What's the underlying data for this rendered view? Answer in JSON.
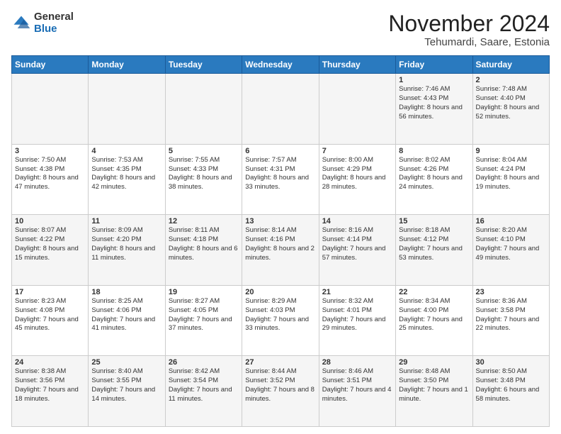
{
  "logo": {
    "general": "General",
    "blue": "Blue"
  },
  "title": {
    "month_year": "November 2024",
    "location": "Tehumardi, Saare, Estonia"
  },
  "weekdays": [
    "Sunday",
    "Monday",
    "Tuesday",
    "Wednesday",
    "Thursday",
    "Friday",
    "Saturday"
  ],
  "weeks": [
    [
      {
        "day": "",
        "sunrise": "",
        "sunset": "",
        "daylight": ""
      },
      {
        "day": "",
        "sunrise": "",
        "sunset": "",
        "daylight": ""
      },
      {
        "day": "",
        "sunrise": "",
        "sunset": "",
        "daylight": ""
      },
      {
        "day": "",
        "sunrise": "",
        "sunset": "",
        "daylight": ""
      },
      {
        "day": "",
        "sunrise": "",
        "sunset": "",
        "daylight": ""
      },
      {
        "day": "1",
        "sunrise": "Sunrise: 7:46 AM",
        "sunset": "Sunset: 4:43 PM",
        "daylight": "Daylight: 8 hours and 56 minutes."
      },
      {
        "day": "2",
        "sunrise": "Sunrise: 7:48 AM",
        "sunset": "Sunset: 4:40 PM",
        "daylight": "Daylight: 8 hours and 52 minutes."
      }
    ],
    [
      {
        "day": "3",
        "sunrise": "Sunrise: 7:50 AM",
        "sunset": "Sunset: 4:38 PM",
        "daylight": "Daylight: 8 hours and 47 minutes."
      },
      {
        "day": "4",
        "sunrise": "Sunrise: 7:53 AM",
        "sunset": "Sunset: 4:35 PM",
        "daylight": "Daylight: 8 hours and 42 minutes."
      },
      {
        "day": "5",
        "sunrise": "Sunrise: 7:55 AM",
        "sunset": "Sunset: 4:33 PM",
        "daylight": "Daylight: 8 hours and 38 minutes."
      },
      {
        "day": "6",
        "sunrise": "Sunrise: 7:57 AM",
        "sunset": "Sunset: 4:31 PM",
        "daylight": "Daylight: 8 hours and 33 minutes."
      },
      {
        "day": "7",
        "sunrise": "Sunrise: 8:00 AM",
        "sunset": "Sunset: 4:29 PM",
        "daylight": "Daylight: 8 hours and 28 minutes."
      },
      {
        "day": "8",
        "sunrise": "Sunrise: 8:02 AM",
        "sunset": "Sunset: 4:26 PM",
        "daylight": "Daylight: 8 hours and 24 minutes."
      },
      {
        "day": "9",
        "sunrise": "Sunrise: 8:04 AM",
        "sunset": "Sunset: 4:24 PM",
        "daylight": "Daylight: 8 hours and 19 minutes."
      }
    ],
    [
      {
        "day": "10",
        "sunrise": "Sunrise: 8:07 AM",
        "sunset": "Sunset: 4:22 PM",
        "daylight": "Daylight: 8 hours and 15 minutes."
      },
      {
        "day": "11",
        "sunrise": "Sunrise: 8:09 AM",
        "sunset": "Sunset: 4:20 PM",
        "daylight": "Daylight: 8 hours and 11 minutes."
      },
      {
        "day": "12",
        "sunrise": "Sunrise: 8:11 AM",
        "sunset": "Sunset: 4:18 PM",
        "daylight": "Daylight: 8 hours and 6 minutes."
      },
      {
        "day": "13",
        "sunrise": "Sunrise: 8:14 AM",
        "sunset": "Sunset: 4:16 PM",
        "daylight": "Daylight: 8 hours and 2 minutes."
      },
      {
        "day": "14",
        "sunrise": "Sunrise: 8:16 AM",
        "sunset": "Sunset: 4:14 PM",
        "daylight": "Daylight: 7 hours and 57 minutes."
      },
      {
        "day": "15",
        "sunrise": "Sunrise: 8:18 AM",
        "sunset": "Sunset: 4:12 PM",
        "daylight": "Daylight: 7 hours and 53 minutes."
      },
      {
        "day": "16",
        "sunrise": "Sunrise: 8:20 AM",
        "sunset": "Sunset: 4:10 PM",
        "daylight": "Daylight: 7 hours and 49 minutes."
      }
    ],
    [
      {
        "day": "17",
        "sunrise": "Sunrise: 8:23 AM",
        "sunset": "Sunset: 4:08 PM",
        "daylight": "Daylight: 7 hours and 45 minutes."
      },
      {
        "day": "18",
        "sunrise": "Sunrise: 8:25 AM",
        "sunset": "Sunset: 4:06 PM",
        "daylight": "Daylight: 7 hours and 41 minutes."
      },
      {
        "day": "19",
        "sunrise": "Sunrise: 8:27 AM",
        "sunset": "Sunset: 4:05 PM",
        "daylight": "Daylight: 7 hours and 37 minutes."
      },
      {
        "day": "20",
        "sunrise": "Sunrise: 8:29 AM",
        "sunset": "Sunset: 4:03 PM",
        "daylight": "Daylight: 7 hours and 33 minutes."
      },
      {
        "day": "21",
        "sunrise": "Sunrise: 8:32 AM",
        "sunset": "Sunset: 4:01 PM",
        "daylight": "Daylight: 7 hours and 29 minutes."
      },
      {
        "day": "22",
        "sunrise": "Sunrise: 8:34 AM",
        "sunset": "Sunset: 4:00 PM",
        "daylight": "Daylight: 7 hours and 25 minutes."
      },
      {
        "day": "23",
        "sunrise": "Sunrise: 8:36 AM",
        "sunset": "Sunset: 3:58 PM",
        "daylight": "Daylight: 7 hours and 22 minutes."
      }
    ],
    [
      {
        "day": "24",
        "sunrise": "Sunrise: 8:38 AM",
        "sunset": "Sunset: 3:56 PM",
        "daylight": "Daylight: 7 hours and 18 minutes."
      },
      {
        "day": "25",
        "sunrise": "Sunrise: 8:40 AM",
        "sunset": "Sunset: 3:55 PM",
        "daylight": "Daylight: 7 hours and 14 minutes."
      },
      {
        "day": "26",
        "sunrise": "Sunrise: 8:42 AM",
        "sunset": "Sunset: 3:54 PM",
        "daylight": "Daylight: 7 hours and 11 minutes."
      },
      {
        "day": "27",
        "sunrise": "Sunrise: 8:44 AM",
        "sunset": "Sunset: 3:52 PM",
        "daylight": "Daylight: 7 hours and 8 minutes."
      },
      {
        "day": "28",
        "sunrise": "Sunrise: 8:46 AM",
        "sunset": "Sunset: 3:51 PM",
        "daylight": "Daylight: 7 hours and 4 minutes."
      },
      {
        "day": "29",
        "sunrise": "Sunrise: 8:48 AM",
        "sunset": "Sunset: 3:50 PM",
        "daylight": "Daylight: 7 hours and 1 minute."
      },
      {
        "day": "30",
        "sunrise": "Sunrise: 8:50 AM",
        "sunset": "Sunset: 3:48 PM",
        "daylight": "Daylight: 6 hours and 58 minutes."
      }
    ]
  ]
}
